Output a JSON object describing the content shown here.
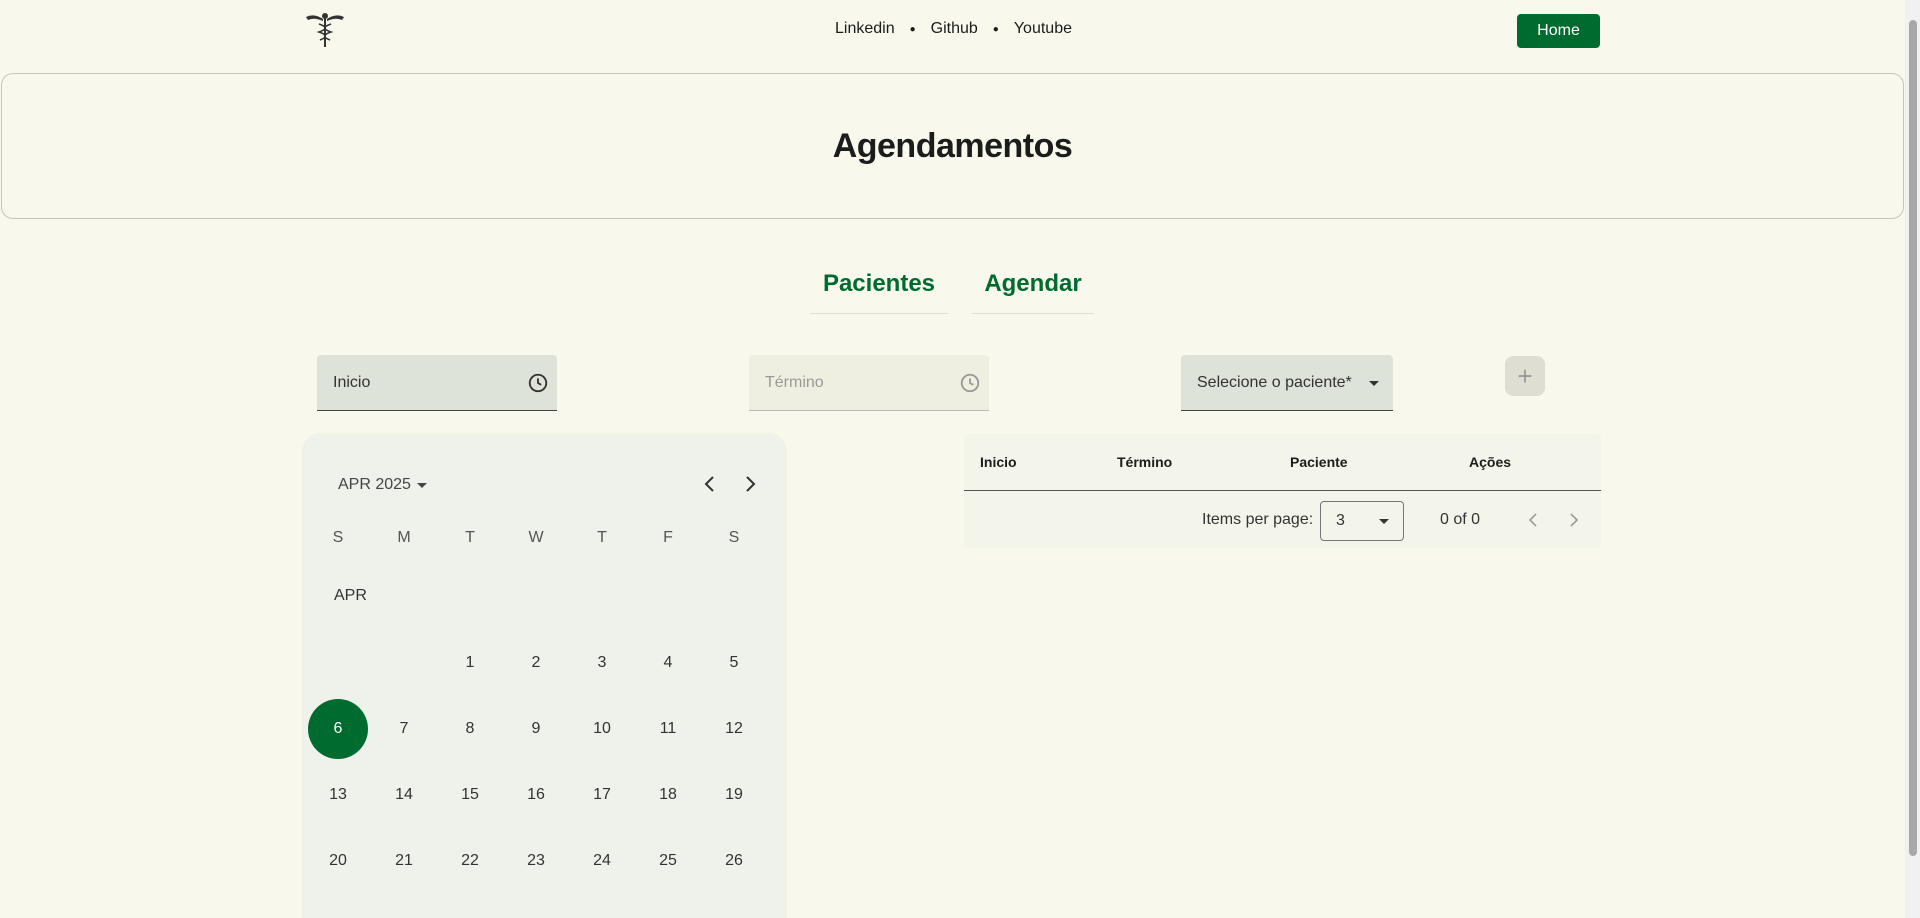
{
  "header": {
    "logo_icon": "caduceus-icon",
    "nav": [
      {
        "label": "Linkedin"
      },
      {
        "label": "Github"
      },
      {
        "label": "Youtube"
      }
    ],
    "home_label": "Home"
  },
  "page": {
    "title": "Agendamentos"
  },
  "tabs": [
    {
      "label": "Pacientes"
    },
    {
      "label": "Agendar"
    }
  ],
  "form": {
    "inicio_label": "Inicio",
    "termino_label": "Término",
    "paciente_placeholder": "Selecione o paciente*",
    "add_icon": "plus-icon",
    "clock_icon": "clock-icon"
  },
  "calendar": {
    "month_label": "APR 2025",
    "month_short": "APR",
    "weekdays": [
      "S",
      "M",
      "T",
      "W",
      "T",
      "F",
      "S"
    ],
    "selected_day": 6,
    "first_weekday": 2,
    "days_visible": 26
  },
  "table": {
    "columns": [
      "Inicio",
      "Término",
      "Paciente",
      "Ações"
    ],
    "rows": [],
    "paginator": {
      "items_per_page_label": "Items per page:",
      "items_per_page": "3",
      "range_label": "0 of 0"
    }
  },
  "colors": {
    "accent": "#006b2f",
    "background": "#f8f9ec"
  }
}
